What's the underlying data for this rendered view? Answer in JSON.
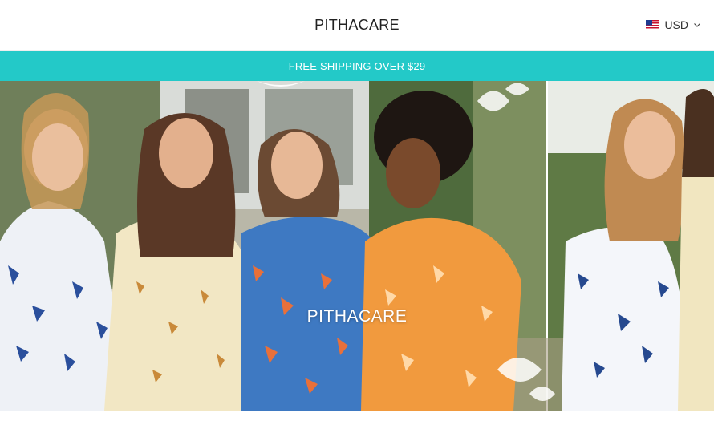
{
  "header": {
    "logo_text": "PITHACARE",
    "currency_label": "USD",
    "currency_flag_icon": "us-flag-icon",
    "dropdown_icon": "chevron-down-icon"
  },
  "announcement": {
    "text": "FREE SHIPPING OVER $29",
    "background_color": "#23c9c8"
  },
  "hero": {
    "title": "PITHACARE"
  }
}
